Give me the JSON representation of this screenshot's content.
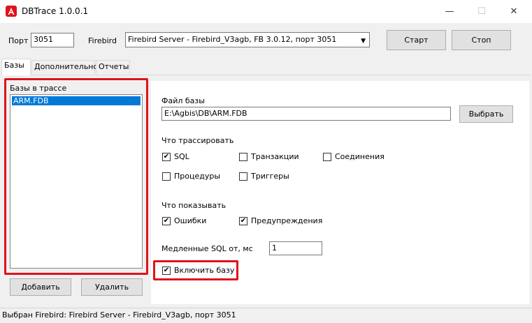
{
  "window": {
    "title": "DBTrace 1.0.0.1",
    "minimize": "—",
    "maximize": "☐",
    "close": "✕"
  },
  "top": {
    "port_label": "Порт",
    "port_value": "3051",
    "firebird_label": "Firebird",
    "firebird_selected": "Firebird Server - Firebird_V3agb, FB 3.0.12, порт 3051",
    "start_button": "Старт",
    "stop_button": "Стоп"
  },
  "tabs": [
    {
      "label": "Базы",
      "active": true
    },
    {
      "label": "Дополнительно",
      "active": false
    },
    {
      "label": "Отчеты",
      "active": false
    }
  ],
  "bases": {
    "group_label": "Базы в трассе",
    "items": [
      "ARM.FDB"
    ],
    "add_button": "Добавить",
    "remove_button": "Удалить"
  },
  "settings": {
    "file_label": "Файл базы",
    "file_value": "E:\\Agbis\\DB\\ARM.FDB",
    "choose_button": "Выбрать",
    "trace_label": "Что трассировать",
    "trace_options": [
      {
        "label": "SQL",
        "checked": true
      },
      {
        "label": "Транзакции",
        "checked": false
      },
      {
        "label": "Соединения",
        "checked": false
      },
      {
        "label": "Процедуры",
        "checked": false
      },
      {
        "label": "Триггеры",
        "checked": false
      }
    ],
    "show_label": "Что показывать",
    "show_options": [
      {
        "label": "Ошибки",
        "checked": true
      },
      {
        "label": "Предупреждения",
        "checked": true
      }
    ],
    "slow_sql_label": "Медленные SQL от, мс",
    "slow_sql_value": "1",
    "enable_base_label": "Включить базу",
    "enable_base_checked": true
  },
  "status": {
    "text": "Выбран Firebird: Firebird Server - Firebird_V3agb, порт 3051"
  },
  "colors": {
    "highlight": "#e0121b",
    "selection": "#0078d7",
    "app_icon": "#e0121b"
  }
}
